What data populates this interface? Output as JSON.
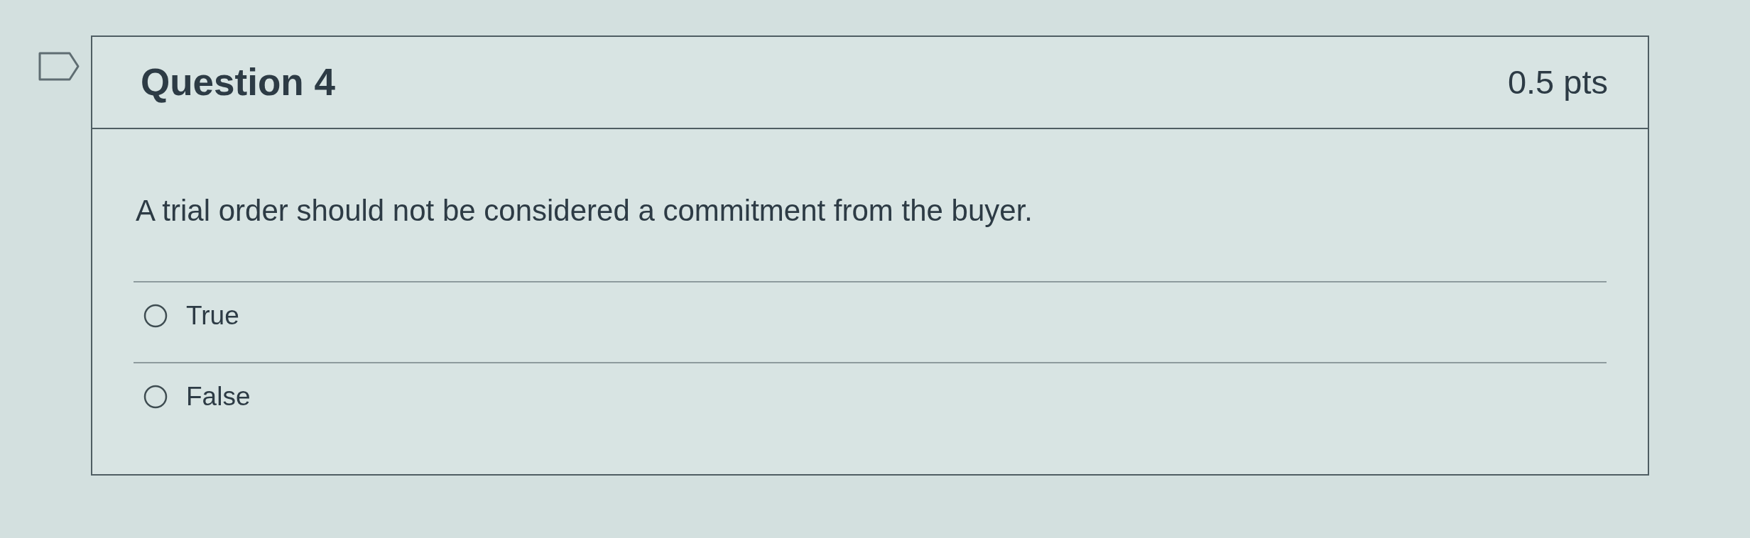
{
  "question": {
    "flagged": false,
    "title": "Question 4",
    "points": "0.5 pts",
    "text": "A trial order should not be considered a commitment from the buyer.",
    "answers": [
      {
        "label": "True",
        "selected": false
      },
      {
        "label": "False",
        "selected": false
      }
    ]
  }
}
